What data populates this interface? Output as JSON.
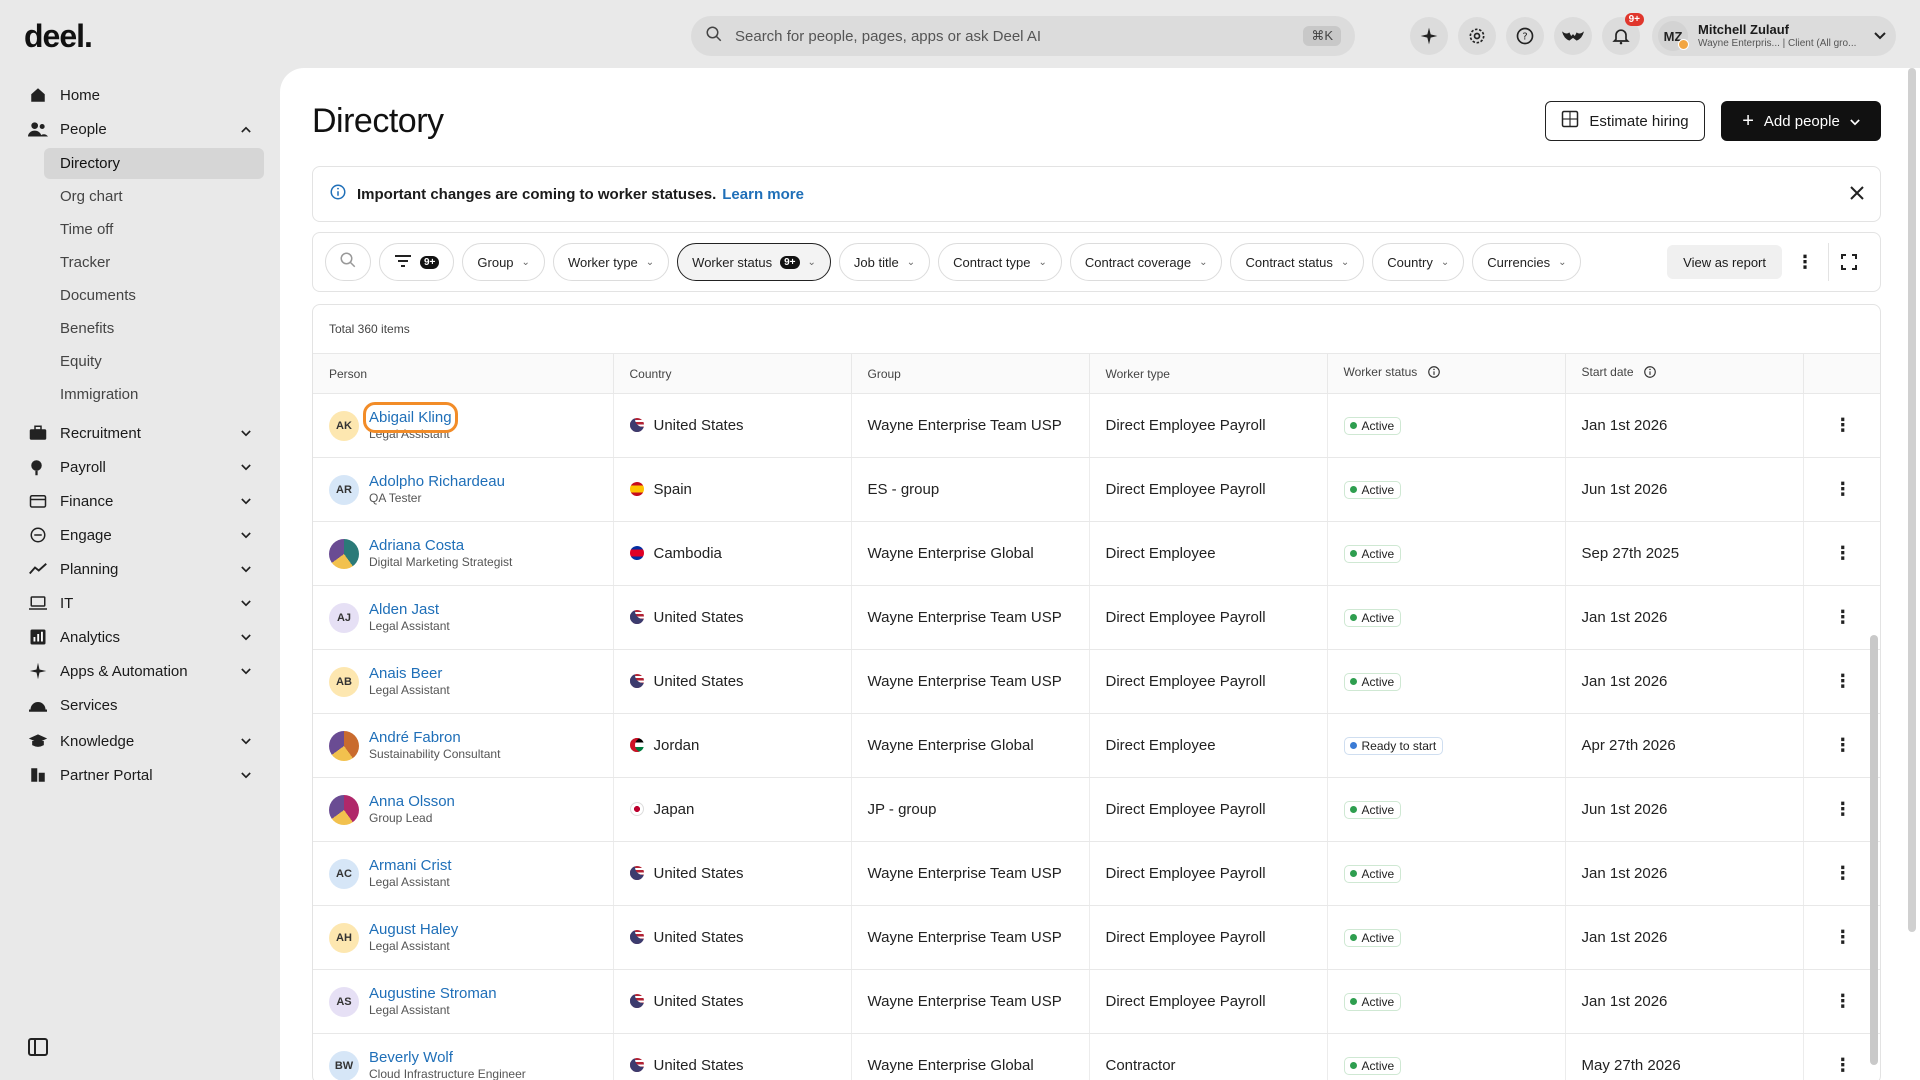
{
  "topbar": {
    "logo": "deel.",
    "search_placeholder": "Search for people, pages, apps or ask Deel AI",
    "shortcut": "⌘K",
    "notifications_badge": "9+",
    "user": {
      "initials": "MZ",
      "name": "Mitchell Zulauf",
      "subtitle": "Wayne Enterpris... | Client (All gro..."
    }
  },
  "sidebar": {
    "items": [
      {
        "label": "Home",
        "icon": "home-icon"
      },
      {
        "label": "People",
        "icon": "people-icon",
        "expanded": true
      },
      {
        "label": "Recruitment",
        "icon": "briefcase-icon"
      },
      {
        "label": "Payroll",
        "icon": "payroll-icon"
      },
      {
        "label": "Finance",
        "icon": "finance-icon"
      },
      {
        "label": "Engage",
        "icon": "engage-icon"
      },
      {
        "label": "Planning",
        "icon": "planning-icon"
      },
      {
        "label": "IT",
        "icon": "laptop-icon"
      },
      {
        "label": "Analytics",
        "icon": "analytics-icon"
      },
      {
        "label": "Apps & Automation",
        "icon": "apps-icon"
      },
      {
        "label": "Services",
        "icon": "services-icon"
      },
      {
        "label": "Knowledge",
        "icon": "knowledge-icon"
      },
      {
        "label": "Partner Portal",
        "icon": "partner-icon"
      }
    ],
    "people_sub": [
      "Directory",
      "Org chart",
      "Time off",
      "Tracker",
      "Documents",
      "Benefits",
      "Equity",
      "Immigration"
    ]
  },
  "page": {
    "title": "Directory",
    "estimate_btn": "Estimate hiring",
    "add_btn": "Add people",
    "banner_text": "Important changes are coming to worker statuses.",
    "banner_link": "Learn more",
    "total": "Total 360 items",
    "view_report": "View as report"
  },
  "filters": {
    "filter_badge": "9+",
    "chips": [
      "Group",
      "Worker type",
      "Worker status",
      "Job title",
      "Contract type",
      "Contract coverage",
      "Contract status",
      "Country",
      "Currencies"
    ],
    "worker_status_badge": "9+"
  },
  "table": {
    "headers": [
      "Person",
      "Country",
      "Group",
      "Worker type",
      "Worker status",
      "Start date"
    ],
    "rows": [
      {
        "initials": "AK",
        "name": "Abigail Kling",
        "role": "Legal Assistant",
        "country": "United States",
        "group": "Wayne Enterprise Team USP",
        "worker_type": "Direct Employee Payroll",
        "status": "Active",
        "start": "Jan 1st 2026"
      },
      {
        "initials": "AR",
        "name": "Adolpho Richardeau",
        "role": "QA Tester",
        "country": "Spain",
        "group": "ES - group",
        "worker_type": "Direct Employee Payroll",
        "status": "Active",
        "start": "Jun 1st 2026"
      },
      {
        "initials": "",
        "name": "Adriana Costa",
        "role": "Digital Marketing Strategist",
        "country": "Cambodia",
        "group": "Wayne Enterprise Global",
        "worker_type": "Direct Employee",
        "status": "Active",
        "start": "Sep 27th 2025"
      },
      {
        "initials": "AJ",
        "name": "Alden Jast",
        "role": "Legal Assistant",
        "country": "United States",
        "group": "Wayne Enterprise Team USP",
        "worker_type": "Direct Employee Payroll",
        "status": "Active",
        "start": "Jan 1st 2026"
      },
      {
        "initials": "AB",
        "name": "Anais Beer",
        "role": "Legal Assistant",
        "country": "United States",
        "group": "Wayne Enterprise Team USP",
        "worker_type": "Direct Employee Payroll",
        "status": "Active",
        "start": "Jan 1st 2026"
      },
      {
        "initials": "",
        "name": "André Fabron",
        "role": "Sustainability Consultant",
        "country": "Jordan",
        "group": "Wayne Enterprise Global",
        "worker_type": "Direct Employee",
        "status": "Ready to start",
        "start": "Apr 27th 2026"
      },
      {
        "initials": "",
        "name": "Anna Olsson",
        "role": "Group Lead",
        "country": "Japan",
        "group": "JP - group",
        "worker_type": "Direct Employee Payroll",
        "status": "Active",
        "start": "Jun 1st 2026"
      },
      {
        "initials": "AC",
        "name": "Armani Crist",
        "role": "Legal Assistant",
        "country": "United States",
        "group": "Wayne Enterprise Team USP",
        "worker_type": "Direct Employee Payroll",
        "status": "Active",
        "start": "Jan 1st 2026"
      },
      {
        "initials": "AH",
        "name": "August Haley",
        "role": "Legal Assistant",
        "country": "United States",
        "group": "Wayne Enterprise Team USP",
        "worker_type": "Direct Employee Payroll",
        "status": "Active",
        "start": "Jan 1st 2026"
      },
      {
        "initials": "AS",
        "name": "Augustine Stroman",
        "role": "Legal Assistant",
        "country": "United States",
        "group": "Wayne Enterprise Team USP",
        "worker_type": "Direct Employee Payroll",
        "status": "Active",
        "start": "Jan 1st 2026"
      },
      {
        "initials": "BW",
        "name": "Beverly Wolf",
        "role": "Cloud Infrastructure Engineer",
        "country": "United States",
        "group": "Wayne Enterprise Global",
        "worker_type": "Contractor",
        "status": "Active",
        "start": "May 27th 2026"
      }
    ]
  },
  "colors": {
    "link": "#1f6fb8",
    "active_dot": "#2e9e4f",
    "ready_dot": "#3a7bd5",
    "focus": "#f28c28"
  }
}
